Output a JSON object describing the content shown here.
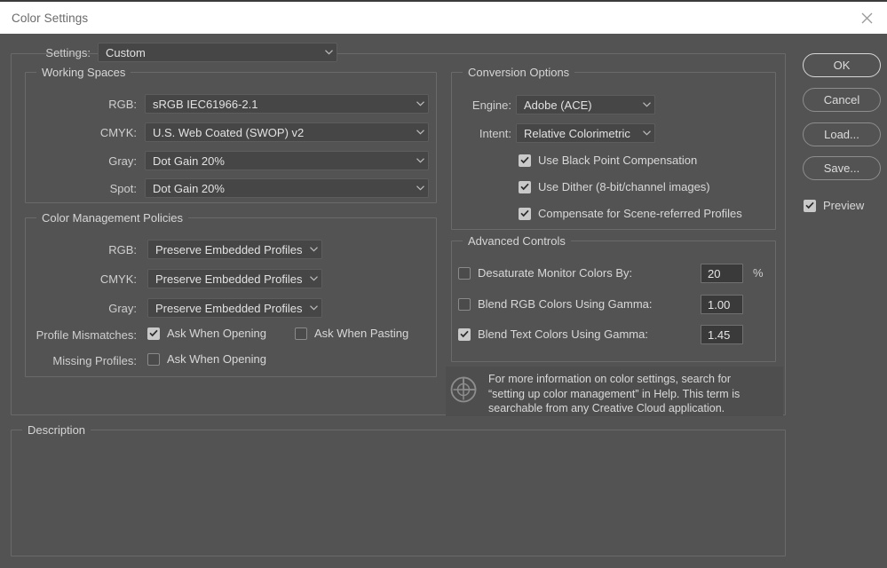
{
  "window": {
    "title": "Color Settings",
    "close_icon": "close-icon"
  },
  "settings_row": {
    "label": "Settings:",
    "value": "Custom"
  },
  "working_spaces": {
    "legend": "Working Spaces",
    "rows": [
      {
        "label": "RGB:",
        "value": "sRGB IEC61966-2.1"
      },
      {
        "label": "CMYK:",
        "value": "U.S. Web Coated (SWOP) v2"
      },
      {
        "label": "Gray:",
        "value": "Dot Gain 20%"
      },
      {
        "label": "Spot:",
        "value": "Dot Gain 20%"
      }
    ]
  },
  "color_management_policies": {
    "legend": "Color Management Policies",
    "rows": [
      {
        "label": "RGB:",
        "value": "Preserve Embedded Profiles"
      },
      {
        "label": "CMYK:",
        "value": "Preserve Embedded Profiles"
      },
      {
        "label": "Gray:",
        "value": "Preserve Embedded Profiles"
      }
    ],
    "profile_mismatches": {
      "label": "Profile Mismatches:",
      "ask_when_opening": {
        "label": "Ask When Opening",
        "checked": true
      },
      "ask_when_pasting": {
        "label": "Ask When Pasting",
        "checked": false
      }
    },
    "missing_profiles": {
      "label": "Missing Profiles:",
      "ask_when_opening": {
        "label": "Ask When Opening",
        "checked": false
      }
    }
  },
  "conversion_options": {
    "legend": "Conversion Options",
    "engine": {
      "label": "Engine:",
      "value": "Adobe (ACE)"
    },
    "intent": {
      "label": "Intent:",
      "value": "Relative Colorimetric"
    },
    "checkboxes": [
      {
        "label": "Use Black Point Compensation",
        "checked": true
      },
      {
        "label": "Use Dither (8-bit/channel images)",
        "checked": true
      },
      {
        "label": "Compensate for Scene-referred Profiles",
        "checked": true
      }
    ]
  },
  "advanced_controls": {
    "legend": "Advanced Controls",
    "rows": [
      {
        "label": "Desaturate Monitor Colors By:",
        "checked": false,
        "value": "20",
        "suffix": "%"
      },
      {
        "label": "Blend RGB Colors Using Gamma:",
        "checked": false,
        "value": "1.00",
        "suffix": ""
      },
      {
        "label": "Blend Text Colors Using Gamma:",
        "checked": true,
        "value": "1.45",
        "suffix": ""
      }
    ]
  },
  "info": {
    "icon": "color-wheel-icon",
    "text": "For more information on color settings, search for\n“setting up color management” in Help. This term is\nsearchable from any Creative Cloud application."
  },
  "description": {
    "legend": "Description",
    "text": ""
  },
  "buttons": {
    "ok": "OK",
    "cancel": "Cancel",
    "load": "Load...",
    "save": "Save...",
    "preview": {
      "label": "Preview",
      "checked": true
    }
  },
  "colors": {
    "dialog_bg": "#535353",
    "titlebar_bg": "#ffffff",
    "group_border": "#6a6a6a",
    "dropdown_bg": "#464646",
    "field_bg": "#3a3a3a",
    "text": "#d4d4d4",
    "checkbox_on": "#c9c9c9"
  }
}
